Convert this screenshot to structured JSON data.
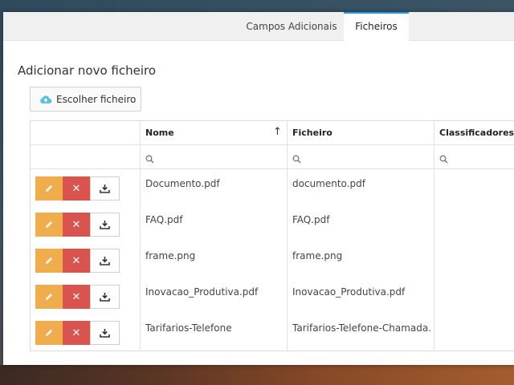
{
  "tabs": [
    {
      "label": "Campos Adicionais",
      "active": false
    },
    {
      "label": "Ficheiros",
      "active": true
    }
  ],
  "section_title": "Adicionar novo ficheiro",
  "upload_button": {
    "label": "Escolher ficheiro",
    "icon": "cloud-upload-icon"
  },
  "table": {
    "columns": [
      "Nome",
      "Ficheiro",
      "Classificadores"
    ],
    "sorted_column": "Nome",
    "sort_direction": "ascending",
    "rows": [
      {
        "nome": "Documento.pdf",
        "ficheiro": "documento.pdf",
        "classificadores": ""
      },
      {
        "nome": "FAQ.pdf",
        "ficheiro": "FAQ.pdf",
        "classificadores": ""
      },
      {
        "nome": "frame.png",
        "ficheiro": "frame.png",
        "classificadores": ""
      },
      {
        "nome": "Inovacao_Produtiva.pdf",
        "ficheiro": "Inovacao_Produtiva.pdf",
        "classificadores": ""
      },
      {
        "nome": "Tarifarios-Telefone",
        "ficheiro": "Tarifarios-Telefone-Chamada...",
        "classificadores": ""
      }
    ]
  },
  "colors": {
    "edit_button": "#f0ad4e",
    "delete_button": "#d9534f",
    "active_tab_accent": "#2196f3",
    "upload_icon": "#5bc0de"
  }
}
